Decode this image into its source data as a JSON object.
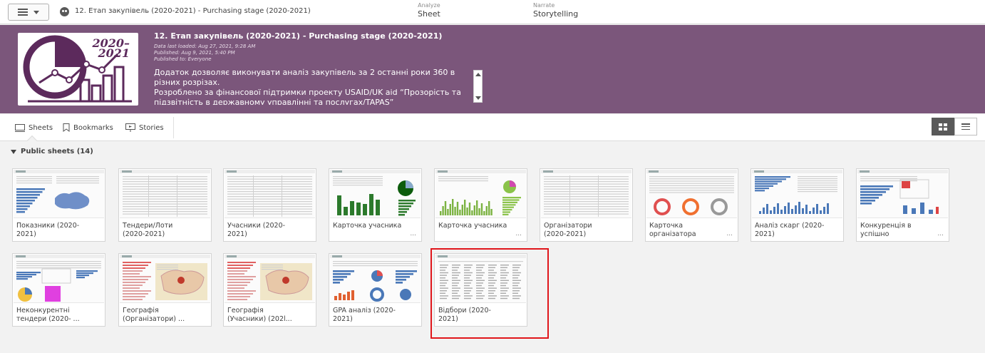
{
  "toolbar": {
    "app_title": "12. Етап закупівель (2020-2021) - Purchasing stage (2020-2021)",
    "modes": [
      {
        "sub": "Analyze",
        "main": "Sheet"
      },
      {
        "sub": "Narrate",
        "main": "Storytelling"
      }
    ]
  },
  "banner": {
    "background_color": "#7b567b",
    "logo_year": "2020-\n2021",
    "app_name": "12. Етап закупівель (2020-2021) - Purchasing stage (2020-2021)",
    "data_last_loaded": "Data last loaded: Aug 27, 2021, 9:28 AM",
    "published": "Published: Aug 9, 2021, 5:40 PM",
    "published_to": "Published to: Everyone",
    "description_1": "Додаток дозволяє виконувати аналіз закупівель за 2 останні роки 360 в різних розрізах.",
    "description_2": "Розроблено за фінансової підтримки проекту USAID/UK aid “Прозорість та підзвітність в державному управлінні та послугах/TAPAS”"
  },
  "tabs": {
    "sheets": "Sheets",
    "bookmarks": "Bookmarks",
    "stories": "Stories"
  },
  "section": {
    "label": "Public sheets (14)"
  },
  "sheets": [
    {
      "title": "Показники (2020-2021)",
      "more": ""
    },
    {
      "title": "Тендери/Лоти (2020-2021)",
      "more": ""
    },
    {
      "title": "Учасники (2020-2021)",
      "more": ""
    },
    {
      "title": "Карточка учасника",
      "more": "..."
    },
    {
      "title": "Карточка учасника",
      "more": "..."
    },
    {
      "title": "Організатори (2020-2021)",
      "more": ""
    },
    {
      "title": "Карточка організатора",
      "more": "..."
    },
    {
      "title": "Аналіз скарг (2020-2021)",
      "more": ""
    },
    {
      "title": "Конкуренція в успішно",
      "more": "..."
    },
    {
      "title": "Неконкурентні тендери (2020- ...",
      "more": ""
    },
    {
      "title": "Географія (Організатори) ...",
      "more": ""
    },
    {
      "title": "Географія (Учасники) (202l...",
      "more": ""
    },
    {
      "title": "GPA аналіз (2020-2021)",
      "more": ""
    },
    {
      "title": "Відбори (2020-2021)",
      "more": ""
    }
  ],
  "selected_sheet": "Відбори (2020-2021)",
  "highlight_color": "#e0161b"
}
